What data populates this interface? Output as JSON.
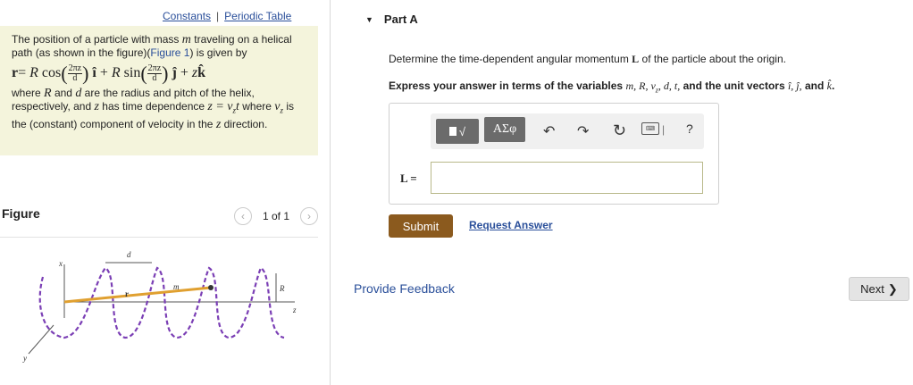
{
  "links": {
    "constants": "Constants",
    "separator": "|",
    "periodic_table": "Periodic Table"
  },
  "problem": {
    "intro": "The position of a particle with mass",
    "mass_var": "m",
    "intro2": "traveling on a helical path (as shown in the figure)(",
    "figure_link": "Figure 1",
    "intro3": ") is given by",
    "eq_lhs": "r",
    "eq_eq": "=",
    "eq_R": "R",
    "eq_cos": "cos",
    "eq_sin": "sin",
    "frac_num": "2πz",
    "frac_den": "d",
    "eq_i": "î",
    "eq_j": "ĵ",
    "eq_plus": "+",
    "eq_z": "z",
    "eq_k": "k̂",
    "desc1": "where",
    "desc_R": "R",
    "desc2": "and",
    "desc_d": "d",
    "desc3": "are the radius and pitch of the helix, respectively, and",
    "desc_z": "z",
    "desc4": "has time dependence",
    "desc_eq": "z = v",
    "desc_sub": "z",
    "desc_t": "t",
    "desc5": "where",
    "desc_vz": "v",
    "desc_vz_sub": "z",
    "desc6": "is the (constant) component of velocity in the",
    "desc_z2": "z",
    "desc7": "direction."
  },
  "figure": {
    "title": "Figure",
    "page": "1 of 1",
    "labels": {
      "x": "x",
      "y": "y",
      "z": "z",
      "d": "d",
      "m": "m",
      "R": "R",
      "r": "r"
    },
    "colors": {
      "helix": "#7b3fb5",
      "rod": "#e0a030"
    }
  },
  "part": {
    "title": "Part A",
    "question": "Determine the time-dependent angular momentum",
    "question_L": "L",
    "question_end": "of the particle about the origin.",
    "instruction": "Express your answer in terms of the variables",
    "instruction_vars": "m, R, v",
    "instruction_vars_sub": "z",
    "instruction_vars2": ", d, t,",
    "instruction_mid": "and the unit vectors",
    "instruction_units": "î, ĵ,",
    "instruction_and": "and",
    "instruction_k": "k̂",
    "instruction_period": "."
  },
  "toolbar": {
    "template_label": "√",
    "greek_label": "ΑΣφ",
    "undo": "↶",
    "redo": "↷",
    "reset": "↻",
    "keyboard": "⌨",
    "bar": "|",
    "help": "?"
  },
  "answer": {
    "label": "L =",
    "value": ""
  },
  "buttons": {
    "submit": "Submit",
    "request": "Request Answer",
    "feedback": "Provide Feedback",
    "next": "Next",
    "next_icon": "❯"
  }
}
